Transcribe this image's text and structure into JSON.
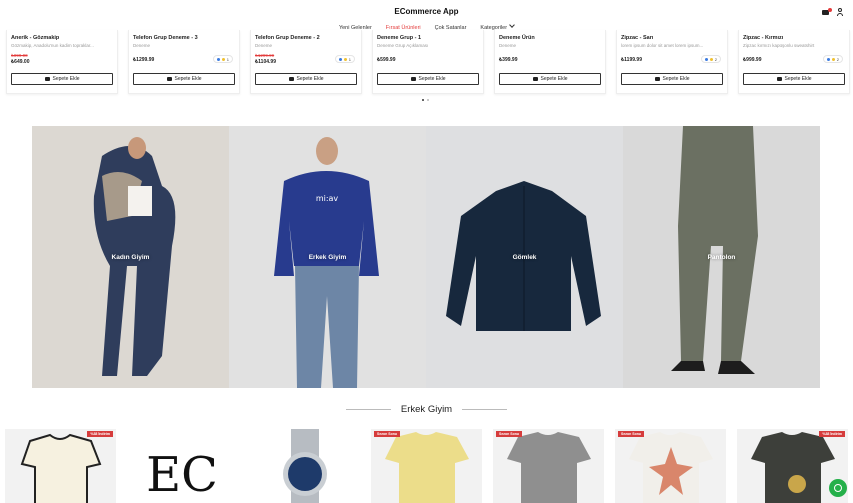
{
  "header": {
    "logo": "ECommerce App",
    "nav": {
      "new_arrivals": "Yeni Gelenler",
      "deals": "Fırsat Ürünleri",
      "best_sellers": "Çok Satanlar",
      "categories": "Kategoriler"
    }
  },
  "carousel": {
    "products": [
      {
        "name": "Anerik - Gözmakip",
        "desc": "Gözmakip, Anadolu'nun kadim topraklar...",
        "old_price": "₺899.00",
        "price": "₺649.00",
        "variants": "",
        "button": "Sepete Ekle"
      },
      {
        "name": "Telefon Grup Deneme - 3",
        "desc": "Deneme",
        "old_price": "",
        "price": "₺1299.99",
        "variants": "1",
        "button": "Sepete Ekle"
      },
      {
        "name": "Telefon Grup Deneme - 2",
        "desc": "Deneme",
        "old_price": "₺1299.99",
        "price": "₺1104.99",
        "variants": "1",
        "button": "Sepete Ekle"
      },
      {
        "name": "Deneme Grup - 1",
        "desc": "Deneme Grup Açıklaması",
        "old_price": "",
        "price": "₺599.99",
        "variants": "",
        "button": "Sepete Ekle"
      },
      {
        "name": "Deneme Ürün",
        "desc": "Deneme",
        "old_price": "",
        "price": "₺399.99",
        "variants": "",
        "button": "Sepete Ekle"
      },
      {
        "name": "Zipzac - Sarı",
        "desc": "lorem ipsum dolor sit amet lorem ipsum...",
        "old_price": "",
        "price": "₺1199.99",
        "variants": "2",
        "button": "Sepete Ekle"
      },
      {
        "name": "Zipzac - Kırmızı",
        "desc": "Zipzac kırmızı kapüşonlu sweatshirt",
        "old_price": "",
        "price": "₺999.99",
        "variants": "2",
        "button": "Sepete Ekle"
      }
    ]
  },
  "categories": [
    {
      "label": "Kadın Giyim"
    },
    {
      "label": "Erkek Giyim"
    },
    {
      "label": "Gömlek"
    },
    {
      "label": "Pantolon"
    }
  ],
  "section": {
    "title": "Erkek Giyim"
  },
  "bottom_products": [
    {
      "tag": "%38 İndirim",
      "tag_side": "right"
    },
    {
      "tag": "",
      "tag_side": "right",
      "logo_text": "EC"
    },
    {
      "tag": "",
      "tag_side": "right"
    },
    {
      "tag": "Sezon Sonu",
      "tag_side": "left"
    },
    {
      "tag": "Sezon Sonu",
      "tag_side": "left"
    },
    {
      "tag": "Sezon Sonu",
      "tag_side": "left"
    },
    {
      "tag": "%38 İndirim",
      "tag_side": "right"
    }
  ],
  "colors": {
    "accent": "#e33b3b",
    "whatsapp": "#25b04a"
  },
  "icons": [
    "cart-icon",
    "user-icon",
    "chevron-down-icon",
    "whatsapp-icon"
  ]
}
